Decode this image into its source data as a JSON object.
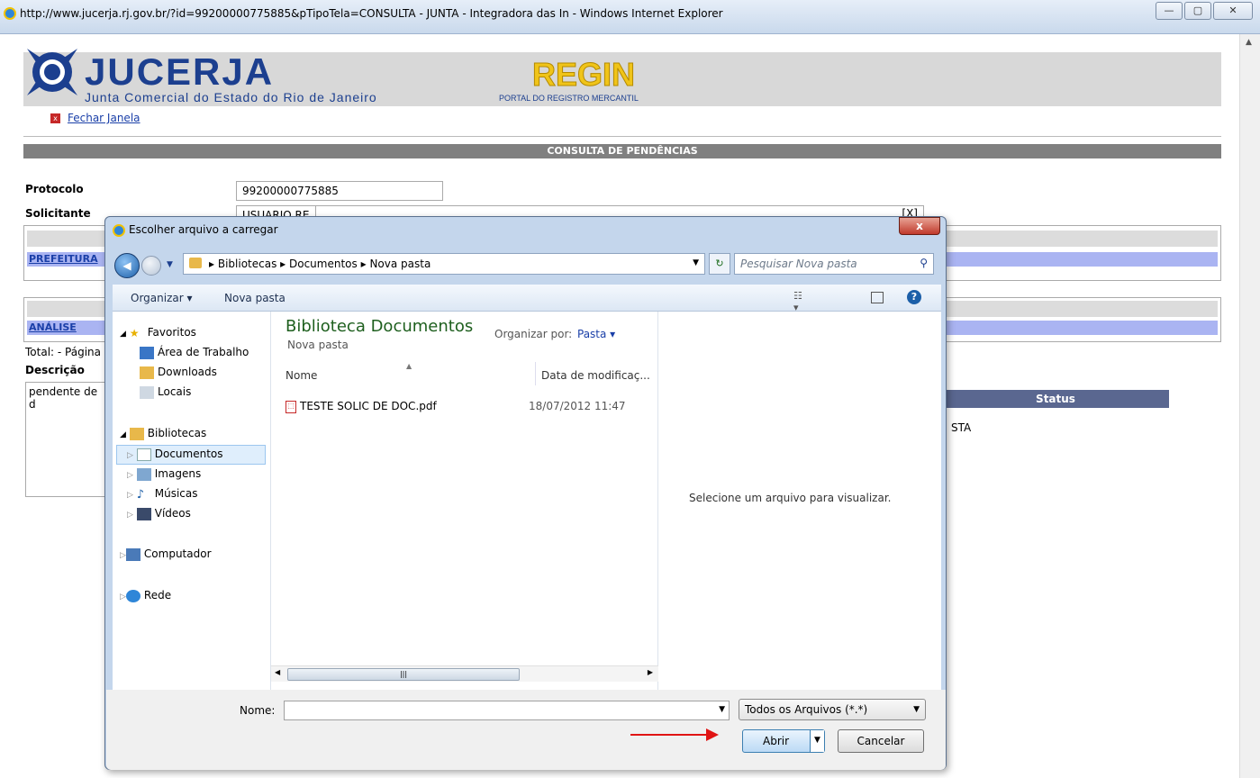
{
  "browser": {
    "title": "http://www.jucerja.rj.gov.br/?id=99200000775885&pTipoTela=CONSULTA - JUNTA - Integradora das In - Windows Internet Explorer"
  },
  "header": {
    "logo_text": "JUCERJA",
    "logo_sub": "Junta Comercial do Estado do Rio de Janeiro",
    "regin": "REGIN",
    "regin_sub": "PORTAL DO REGISTRO MERCANTIL",
    "close_link": "Fechar Janela"
  },
  "page": {
    "section_title": "CONSULTA DE PENDÊNCIAS",
    "protocolo_label": "Protocolo",
    "protocolo_value": "99200000775885",
    "solicitante_label": "Solicitante",
    "solicitante_value": "USUARIO RE",
    "prefeitura_link": "PREFEITURA",
    "analise_link": "ANÁLISE",
    "total_text": "Total: - Página",
    "descricao_label": "Descrição",
    "descricao_value": "pendente de d",
    "status_header": "Status",
    "status_value": "STA",
    "overlay_close": "[X]"
  },
  "dialog": {
    "title": "Escolher arquivo a carregar",
    "close": "x",
    "breadcrumb": [
      "Bibliotecas",
      "Documentos",
      "Nova pasta"
    ],
    "search_placeholder": "Pesquisar Nova pasta",
    "toolbar": {
      "organize": "Organizar ▾",
      "new_folder": "Nova pasta"
    },
    "nav": {
      "favorites": "Favoritos",
      "desktop": "Área de Trabalho",
      "downloads": "Downloads",
      "locais": "Locais",
      "libraries": "Bibliotecas",
      "documents": "Documentos",
      "images": "Imagens",
      "music": "Músicas",
      "videos": "Vídeos",
      "computer": "Computador",
      "network": "Rede"
    },
    "content": {
      "library_title": "Biblioteca Documentos",
      "library_sub": "Nova pasta",
      "arrange_label": "Organizar por:",
      "arrange_value": "Pasta ▾",
      "col_name": "Nome",
      "col_date": "Data de modificaç...",
      "files": [
        {
          "name": "TESTE SOLIC DE DOC.pdf",
          "date": "18/07/2012 11:47"
        }
      ]
    },
    "preview_text": "Selecione um arquivo para visualizar.",
    "filename_label": "Nome:",
    "filename_value": "",
    "filter_value": "Todos os Arquivos (*.*)",
    "open_button": "Abrir",
    "cancel_button": "Cancelar"
  }
}
